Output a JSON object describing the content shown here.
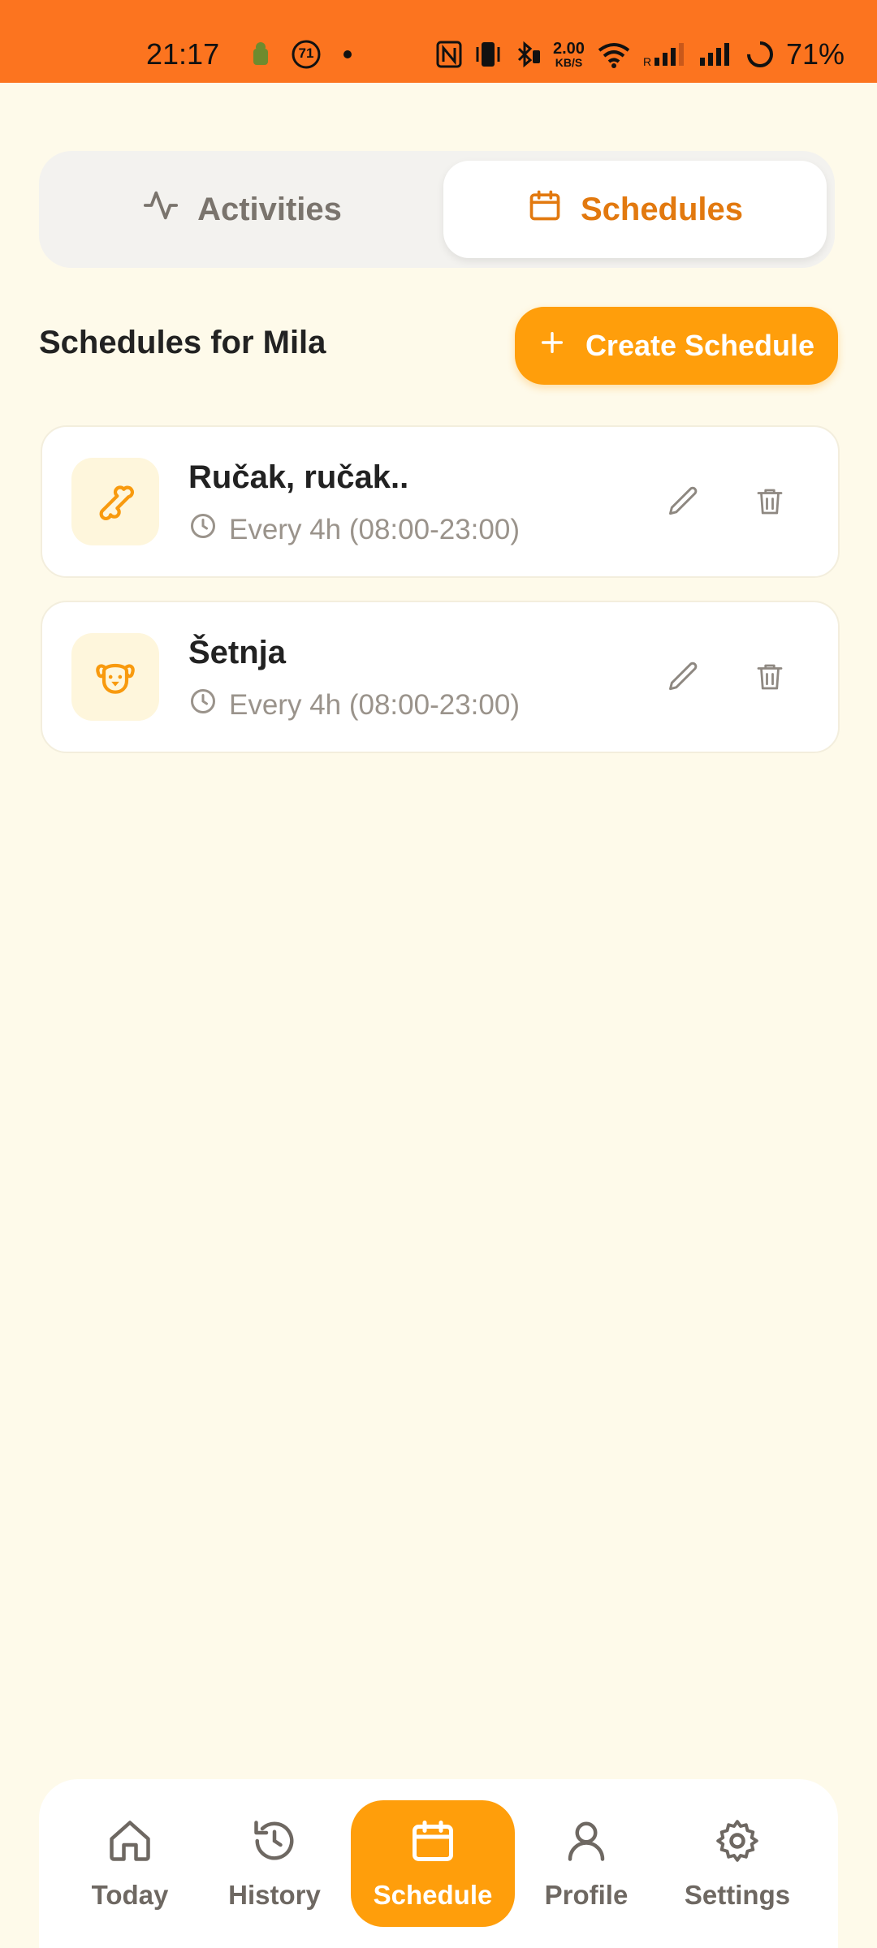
{
  "status_bar": {
    "time": "21:17",
    "badge_number": "71",
    "speed_value": "2.00",
    "speed_unit": "KB/S",
    "battery": "71%",
    "background": "#FC741F"
  },
  "tabs": [
    {
      "label": "Activities",
      "icon": "activity-icon",
      "active": false
    },
    {
      "label": "Schedules",
      "icon": "calendar-icon",
      "active": true
    }
  ],
  "header": {
    "title": "Schedules for Mila",
    "create_label": "Create Schedule"
  },
  "schedules": [
    {
      "title": "Ručak, ručak..",
      "frequency": "Every 4h (08:00-23:00)",
      "icon": "bone-icon"
    },
    {
      "title": "Šetnja",
      "frequency": "Every 4h (08:00-23:00)",
      "icon": "dog-icon"
    }
  ],
  "nav": [
    {
      "label": "Today",
      "icon": "home-icon"
    },
    {
      "label": "History",
      "icon": "history-icon"
    },
    {
      "label": "Schedule",
      "icon": "calendar-icon",
      "active": true
    },
    {
      "label": "Profile",
      "icon": "user-icon"
    },
    {
      "label": "Settings",
      "icon": "gear-icon"
    }
  ],
  "colors": {
    "accent": "#FF9E0B",
    "accent_text": "#E2790F",
    "background": "#FEFAEA",
    "muted": "#9A938B"
  }
}
